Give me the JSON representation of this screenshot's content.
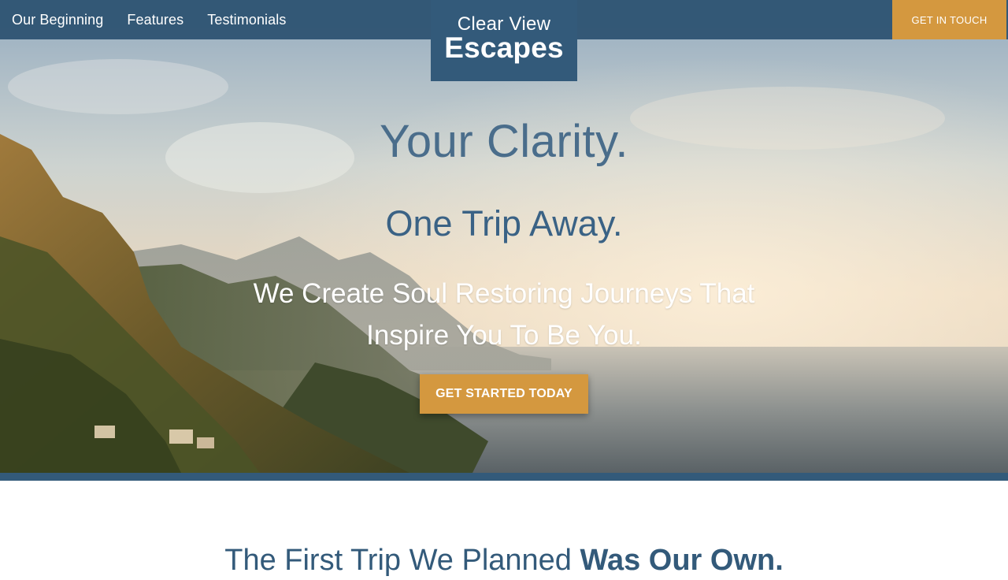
{
  "nav": {
    "links": [
      "Our Beginning",
      "Features",
      "Testimonials"
    ],
    "logo_line1": "Clear View",
    "logo_line2": "Escapes",
    "cta_label": "GET IN TOUCH"
  },
  "hero": {
    "headline_1": "Your Clarity.",
    "headline_2": "One Trip Away.",
    "tagline": "We Create Soul Restoring Journeys That Inspire You To Be You.",
    "cta_label": "GET STARTED TODAY"
  },
  "section": {
    "title_regular": "The First Trip We Planned ",
    "title_bold": "Was Our Own."
  },
  "colors": {
    "primary": "#335a7a",
    "accent": "#d4983f",
    "white": "#ffffff"
  }
}
